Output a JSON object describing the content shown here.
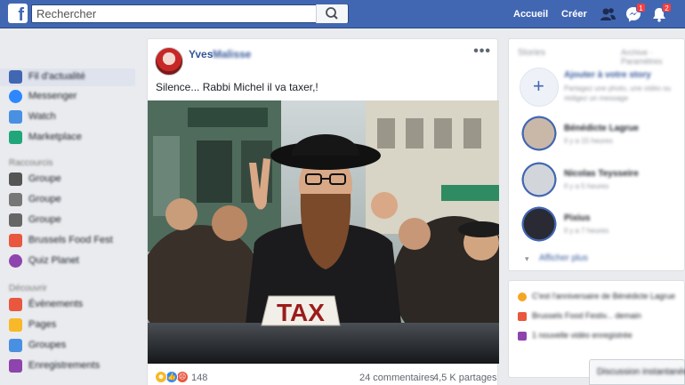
{
  "topbar": {
    "logo": "f",
    "search_placeholder": "Rechercher",
    "nav": {
      "home": "Accueil",
      "create": "Créer"
    },
    "icons": [
      "friends-icon",
      "messenger-icon",
      "notifications-icon"
    ],
    "badges": {
      "messenger": "1",
      "notifications": "2"
    }
  },
  "sidebar": {
    "items": [
      {
        "label": "Fil d'actualité",
        "color": "#4267b2"
      },
      {
        "label": "Messenger",
        "color": "#2d88ff"
      },
      {
        "label": "Watch",
        "color": "#4a90e2"
      },
      {
        "label": "Marketplace",
        "color": "#21a67a"
      }
    ],
    "section_shortcuts": "Raccourcis",
    "shortcuts": [
      {
        "label": "Groupe",
        "color": "#555"
      },
      {
        "label": "Groupe",
        "color": "#777"
      },
      {
        "label": "Groupe",
        "color": "#666"
      },
      {
        "label": "Brussels Food Fest",
        "color": "#e9573f"
      },
      {
        "label": "Quiz Planet",
        "color": "#8e44ad"
      }
    ],
    "section_explore": "Découvrir",
    "explore": [
      {
        "label": "Évènements",
        "color": "#e9573f"
      },
      {
        "label": "Pages",
        "color": "#f7b928"
      },
      {
        "label": "Groupes",
        "color": "#4a90e2"
      },
      {
        "label": "Enregistrements",
        "color": "#8e44ad"
      }
    ]
  },
  "post": {
    "author_first": "Yves",
    "author_last": "Malisse",
    "text": "Silence... Rabbi Michel il va taxer,!",
    "image_sign": "TAX",
    "reactions_count": "148",
    "comments": "24 commentaires",
    "shares": "4,5 K partages"
  },
  "right": {
    "stories_title": "Stories",
    "stories_link": "Archive · Paramètres",
    "add_story": "Ajouter à votre story",
    "add_story_sub": "Partagez une photo, une vidéo ou rédigez un message",
    "stories": [
      {
        "name": "Bénédicte Lagrue",
        "time": "Il y a 15 heures"
      },
      {
        "name": "Nicolas Teysseire",
        "time": "Il y a 5 heures"
      },
      {
        "name": "Pixius",
        "time": "Il y a 7 heures"
      }
    ],
    "see_more": "Afficher plus",
    "events": [
      "C'est l'anniversaire de Bénédicte Lagrue",
      "Brussels Food Festiv... demain",
      "1 nouvelle vidéo enregistrée"
    ],
    "chat_label": "Discussion instantanée"
  }
}
